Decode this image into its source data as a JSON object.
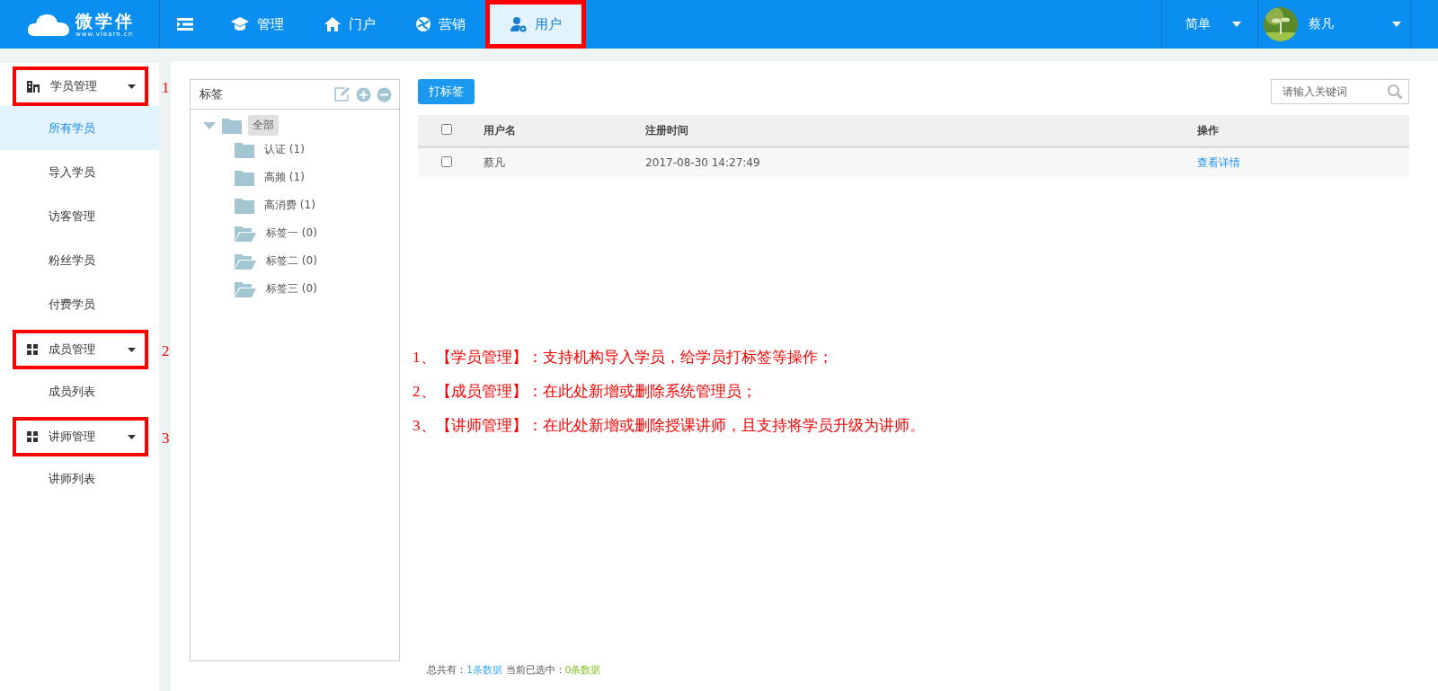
{
  "header": {
    "logo": {
      "name": "微学伴",
      "url": "www.vlearn.cn"
    },
    "nav": [
      {
        "label": "管理",
        "selected": false,
        "highlighted": false
      },
      {
        "label": "门户",
        "selected": false,
        "highlighted": false
      },
      {
        "label": "营销",
        "selected": false,
        "highlighted": false
      },
      {
        "label": "用户",
        "selected": true,
        "highlighted": true
      }
    ],
    "mode": "简单",
    "user": {
      "name": "蔡凡"
    }
  },
  "sidebar": {
    "groups": [
      {
        "title": "学员管理",
        "marker": "1",
        "highlighted": true,
        "expanded": true,
        "items": [
          {
            "label": "所有学员",
            "selected": true
          },
          {
            "label": "导入学员",
            "selected": false
          },
          {
            "label": "访客管理",
            "selected": false
          },
          {
            "label": "粉丝学员",
            "selected": false
          },
          {
            "label": "付费学员",
            "selected": false
          }
        ]
      },
      {
        "title": "成员管理",
        "marker": "2",
        "highlighted": true,
        "expanded": true,
        "items": [
          {
            "label": "成员列表",
            "selected": false
          }
        ]
      },
      {
        "title": "讲师管理",
        "marker": "3",
        "highlighted": true,
        "expanded": true,
        "items": [
          {
            "label": "讲师列表",
            "selected": false
          }
        ]
      }
    ]
  },
  "tag_panel": {
    "title": "标签",
    "root": {
      "label": "全部",
      "expanded": true,
      "selected": true,
      "children": [
        {
          "label": "认证 (1)",
          "kind": "full"
        },
        {
          "label": "高频 (1)",
          "kind": "full"
        },
        {
          "label": "高消费 (1)",
          "kind": "full"
        },
        {
          "label": "标签一 (0)",
          "kind": "empty"
        },
        {
          "label": "标签二 (0)",
          "kind": "empty"
        },
        {
          "label": "标签三 (0)",
          "kind": "empty"
        }
      ]
    }
  },
  "toolbar": {
    "button": "打标签",
    "search": {
      "placeholder": "请输入关键词"
    }
  },
  "table": {
    "header_checked": false,
    "columns": [
      "用户名",
      "注册时间",
      "操作"
    ],
    "rows": [
      {
        "checked": false,
        "cells": [
          "蔡凡",
          "2017-08-30 14:27:49"
        ],
        "action": "查看详情"
      }
    ]
  },
  "notes": [
    "1、【学员管理】：支持机构导入学员，给学员打标签等操作；",
    "2、【成员管理】：在此处新增或删除系统管理员；",
    "3、【讲师管理】：在此处新增或删除授课讲师，且支持将学员升级为讲师。"
  ],
  "status_bar": {
    "total_label": "总共有：",
    "total": "1条数据",
    "selected_label": "当前已选中：",
    "selected": "0条数据"
  }
}
